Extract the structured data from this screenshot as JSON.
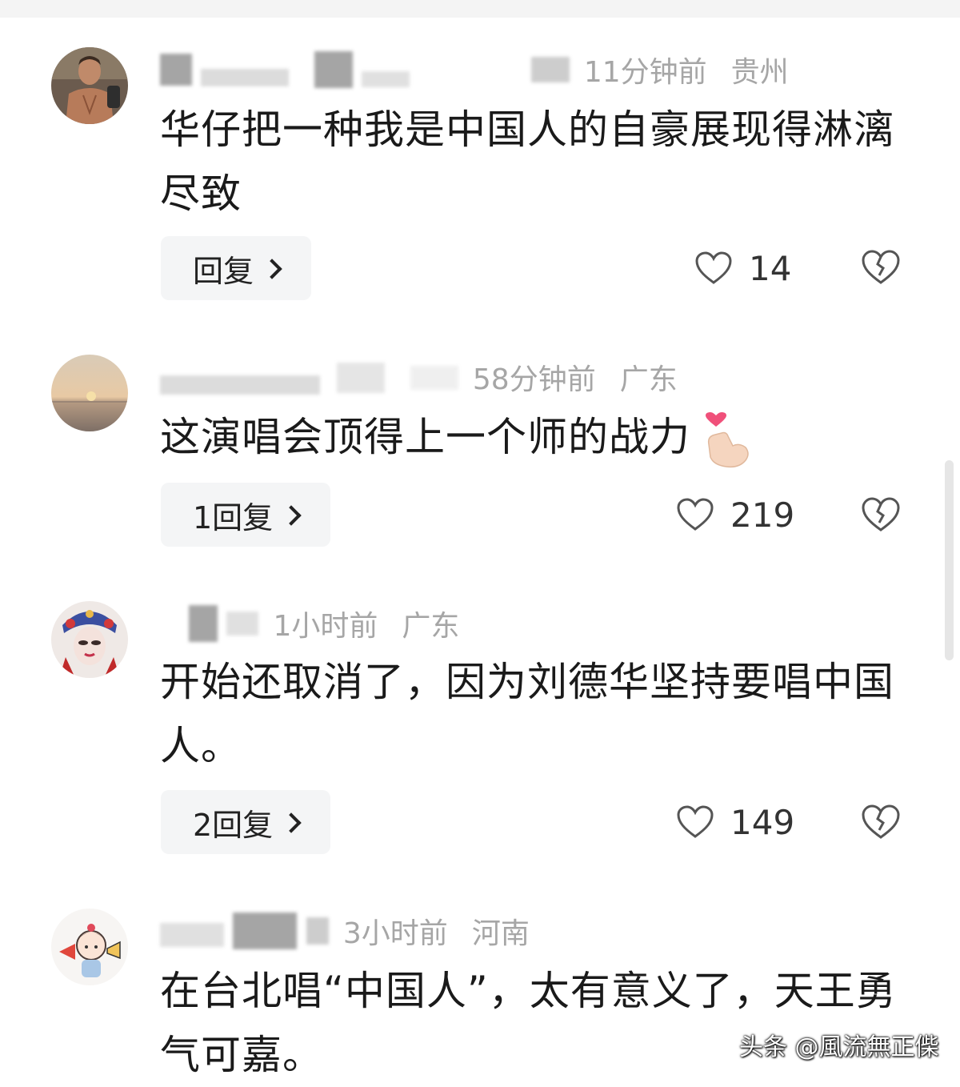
{
  "comments": [
    {
      "time": "11分钟前",
      "location": "贵州",
      "text": "华仔把一种我是中国人的自豪展现得淋漓尽致",
      "reply_label": "回复",
      "likes": "14",
      "avatar": "muscular-man-avatar"
    },
    {
      "time": "58分钟前",
      "location": "广东",
      "text": "这演唱会顶得上一个师的战力",
      "reply_label": "1回复",
      "likes": "219",
      "avatar": "sunset-sea-avatar"
    },
    {
      "time": "1小时前",
      "location": "广东",
      "text": "开始还取消了，因为刘德华坚持要唱中国人。",
      "reply_label": "2回复",
      "likes": "149",
      "avatar": "opera-face-avatar"
    },
    {
      "time": "3小时前",
      "location": "河南",
      "text": "在台北唱“中国人”，太有意义了，天王勇气可嘉。",
      "avatar": "cartoon-girl-megaphone-avatar"
    }
  ],
  "watermark": "头条 @風流無正偨",
  "colors": {
    "meta_text": "#a6a6a6",
    "reply_bg": "#f4f5f6",
    "heart_emoji": "#f0507a"
  }
}
